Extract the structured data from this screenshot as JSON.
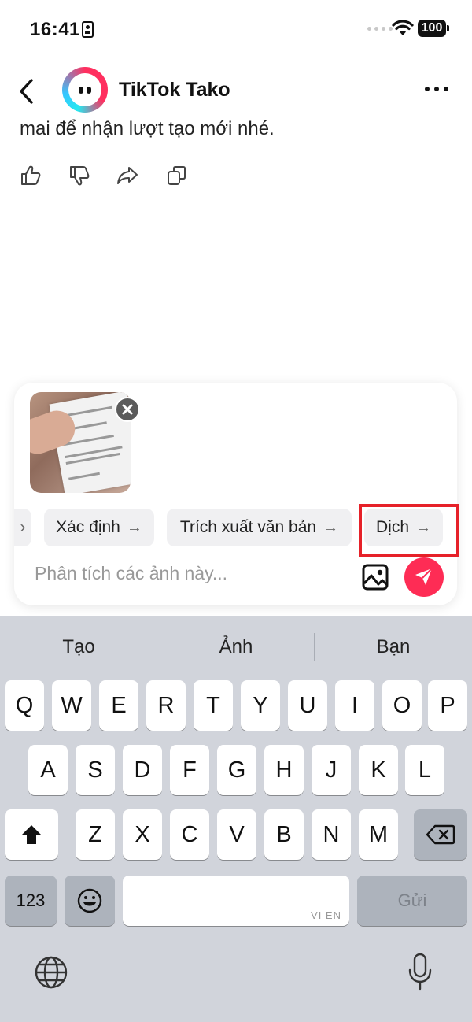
{
  "status_bar": {
    "time": "16:41",
    "battery": "100"
  },
  "header": {
    "title": "TikTok Tako",
    "back_icon": "chevron-left-icon",
    "more_icon": "more-horizontal-icon"
  },
  "message": {
    "text": "mai để nhận lượt tạo mới nhé.",
    "actions": [
      "thumbs-up-icon",
      "thumbs-down-icon",
      "share-icon",
      "copy-icon"
    ]
  },
  "composer": {
    "attachment_alt": "clothing care label photo",
    "chips": [
      {
        "label": "Xác định",
        "arrow": "→"
      },
      {
        "label": "Trích xuất văn bản",
        "arrow": "→"
      },
      {
        "label": "Dịch",
        "arrow": "→"
      }
    ],
    "partial_chip_arrow": "›",
    "input_placeholder": "Phân tích các ảnh này...",
    "accent_color": "#fe2c55",
    "highlight_color": "#e62129"
  },
  "keyboard": {
    "suggestions": [
      "Tạo",
      "Ảnh",
      "Bạn"
    ],
    "row1": [
      "Q",
      "W",
      "E",
      "R",
      "T",
      "Y",
      "U",
      "I",
      "O",
      "P"
    ],
    "row2": [
      "A",
      "S",
      "D",
      "F",
      "G",
      "H",
      "J",
      "K",
      "L"
    ],
    "row3": [
      "Z",
      "X",
      "C",
      "V",
      "B",
      "N",
      "M"
    ],
    "numbers_key": "123",
    "send_key": "Gửi",
    "space_lang": "VI EN"
  }
}
